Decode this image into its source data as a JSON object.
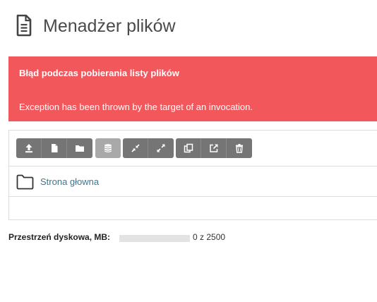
{
  "header": {
    "title": "Menadżer plików",
    "icon": "document-icon"
  },
  "alert": {
    "title": "Błąd podczas pobierania listy plików",
    "message": "Exception has been thrown by the target of an invocation.",
    "color": "#f2575c"
  },
  "toolbar": {
    "groups": [
      [
        "upload-icon",
        "new-file-icon",
        "new-folder-icon"
      ],
      [
        "database-icon"
      ],
      [
        "compress-icon",
        "expand-icon"
      ],
      [
        "copy-icon",
        "open-external-icon",
        "trash-icon"
      ]
    ]
  },
  "folder": {
    "label": "Strona głowna",
    "icon": "folder-icon"
  },
  "disk": {
    "label": "Przestrzeń dyskowa, MB:",
    "usage_text": "0 z 2500",
    "used_fraction": 0
  }
}
